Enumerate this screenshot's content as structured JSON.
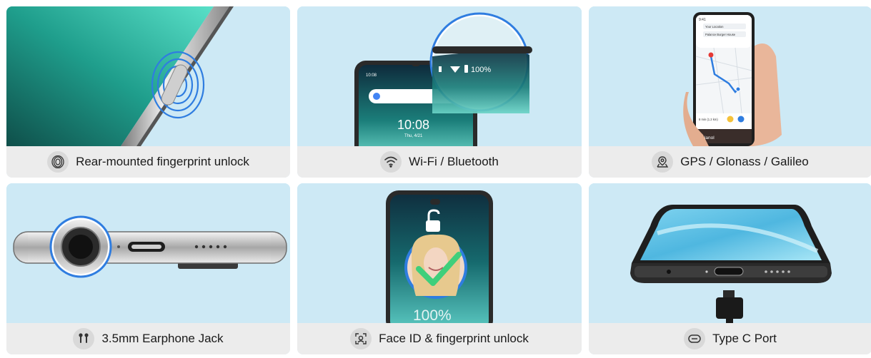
{
  "features": [
    {
      "label": "Rear-mounted fingerprint unlock",
      "icon": "fingerprint-icon"
    },
    {
      "label": "Wi-Fi / Bluetooth",
      "icon": "wifi-icon"
    },
    {
      "label": "GPS / Glonass / Galileo",
      "icon": "location-pin-icon"
    },
    {
      "label": "3.5mm Earphone Jack",
      "icon": "earphones-icon"
    },
    {
      "label": "Face ID & fingerprint unlock",
      "icon": "face-scan-icon"
    },
    {
      "label": "Type C Port",
      "icon": "usb-c-icon"
    }
  ],
  "wifi_scene": {
    "status_time": "10:08",
    "battery": "100%",
    "clock": "10:08",
    "date": "Thu, 4/21"
  },
  "gps_scene": {
    "time": "9:41",
    "from": "Your Location",
    "to": "Palance Burger House",
    "place": "Palanol",
    "eta": "8 min (1.2 km)"
  },
  "face_scene": {
    "percent": "100%"
  },
  "colors": {
    "card_bg": "#cde9f5",
    "caption_bg": "#ececec",
    "accent_blue": "#2f7de0",
    "teal": "#2ab7a6"
  }
}
